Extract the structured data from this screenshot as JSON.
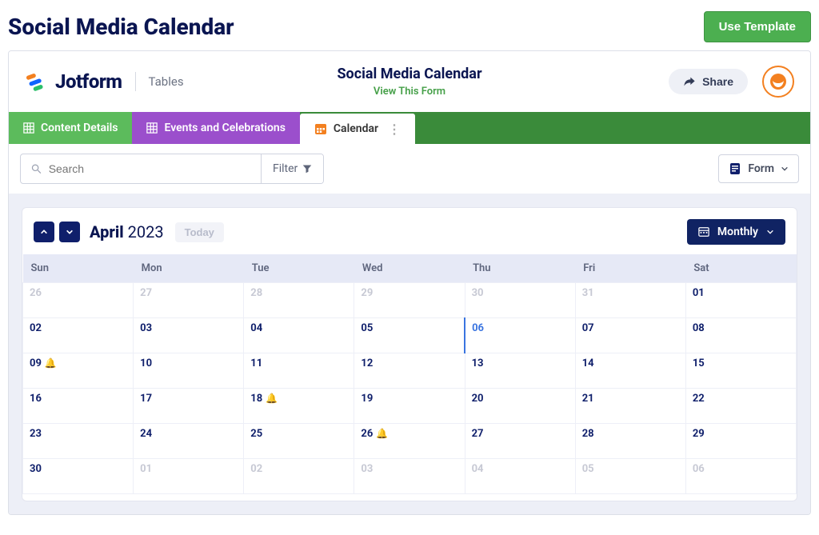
{
  "page": {
    "title": "Social Media Calendar",
    "use_template": "Use Template"
  },
  "header": {
    "brand": "Jotform",
    "section": "Tables",
    "title": "Social Media Calendar",
    "view_form": "View This Form",
    "share": "Share"
  },
  "tabs": {
    "t1": "Content Details",
    "t2": "Events and Celebrations",
    "t3": "Calendar"
  },
  "toolbar": {
    "search_placeholder": "Search",
    "filter": "Filter",
    "form": "Form"
  },
  "calendar": {
    "month": "April",
    "year": "2023",
    "today": "Today",
    "view": "Monthly",
    "dow": [
      "Sun",
      "Mon",
      "Tue",
      "Wed",
      "Thu",
      "Fri",
      "Sat"
    ],
    "weeks": [
      [
        {
          "d": "26",
          "o": true
        },
        {
          "d": "27",
          "o": true
        },
        {
          "d": "28",
          "o": true
        },
        {
          "d": "29",
          "o": true
        },
        {
          "d": "30",
          "o": true
        },
        {
          "d": "31",
          "o": true
        },
        {
          "d": "01"
        }
      ],
      [
        {
          "d": "02"
        },
        {
          "d": "03"
        },
        {
          "d": "04"
        },
        {
          "d": "05"
        },
        {
          "d": "06",
          "today": true
        },
        {
          "d": "07"
        },
        {
          "d": "08"
        }
      ],
      [
        {
          "d": "09",
          "bell": true
        },
        {
          "d": "10"
        },
        {
          "d": "11"
        },
        {
          "d": "12"
        },
        {
          "d": "13"
        },
        {
          "d": "14"
        },
        {
          "d": "15"
        }
      ],
      [
        {
          "d": "16"
        },
        {
          "d": "17"
        },
        {
          "d": "18",
          "bell": true
        },
        {
          "d": "19"
        },
        {
          "d": "20"
        },
        {
          "d": "21"
        },
        {
          "d": "22"
        }
      ],
      [
        {
          "d": "23"
        },
        {
          "d": "24"
        },
        {
          "d": "25"
        },
        {
          "d": "26",
          "bell": true
        },
        {
          "d": "27"
        },
        {
          "d": "28"
        },
        {
          "d": "29"
        }
      ],
      [
        {
          "d": "30"
        },
        {
          "d": "01",
          "o": true
        },
        {
          "d": "02",
          "o": true
        },
        {
          "d": "03",
          "o": true
        },
        {
          "d": "04",
          "o": true
        },
        {
          "d": "05",
          "o": true
        },
        {
          "d": "06",
          "o": true
        }
      ]
    ]
  }
}
